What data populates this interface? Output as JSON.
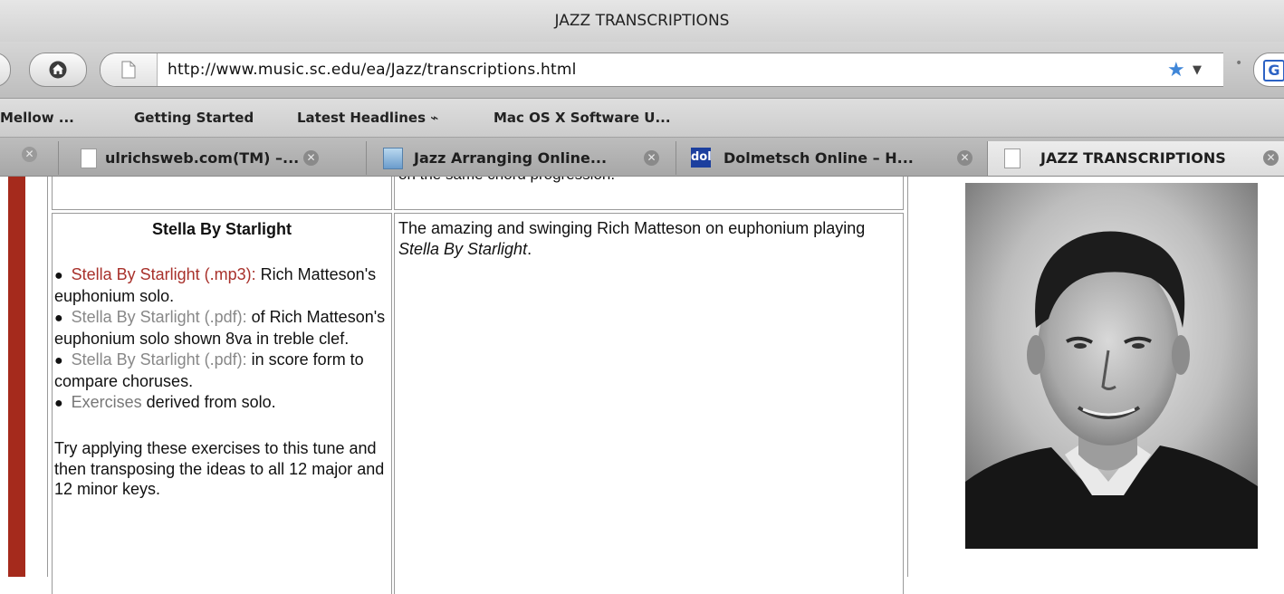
{
  "window": {
    "title": "JAZZ TRANSCRIPTIONS"
  },
  "navigation": {
    "url": "http://www.music.sc.edu/ea/Jazz/transcriptions.html",
    "home_icon": "home-icon",
    "page_icon": "document-icon",
    "bookmark_icon": "star-icon",
    "search_icon": "google-icon"
  },
  "bookmarks_bar": {
    "items": [
      {
        "label": "Mellow ..."
      },
      {
        "label": "Getting Started"
      },
      {
        "label": "Latest Headlines ⌁"
      },
      {
        "label": "Mac OS X Software U..."
      }
    ]
  },
  "tabs": [
    {
      "label": "ulrichsweb.com(TM) –...",
      "active": false
    },
    {
      "label": "Jazz Arranging Online...",
      "active": false
    },
    {
      "label": "Dolmetsch Online – H...",
      "active": false,
      "favicon_text": "dol"
    },
    {
      "label": "JAZZ TRANSCRIPTIONS",
      "active": true
    }
  ],
  "page": {
    "previous_row_cutoff_text": "on the same chord progression.",
    "entry": {
      "title": "Stella By Starlight",
      "items": [
        {
          "link": "Stella By Starlight (.mp3):",
          "text": " Rich Matteson's euphonium solo."
        },
        {
          "link": "Stella By Starlight (.pdf):",
          "text": " of Rich Matteson's euphonium solo shown 8va in treble clef."
        },
        {
          "link": "Stella By Starlight (.pdf):",
          "text": " in score form to compare choruses."
        },
        {
          "link": "Exercises",
          "text": " derived from solo."
        }
      ],
      "note": "Try applying these exercises to this tune and then transposing the ideas to all 12 major and 12 minor keys.",
      "description_prefix": "The amazing and swinging Rich Matteson on euphonium playing ",
      "description_italic": "Stella By Starlight",
      "description_suffix": "."
    },
    "accent_color": "#a52a1c",
    "link_color": "#a8312b"
  }
}
